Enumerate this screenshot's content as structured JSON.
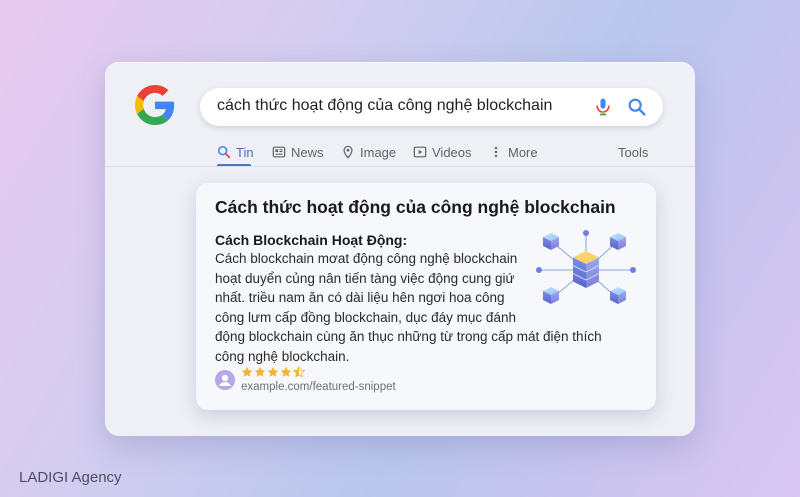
{
  "search": {
    "query": "cách thức hoạt động của công nghệ blockchain"
  },
  "tabs": [
    {
      "label": "Tin",
      "icon": "search-icon",
      "active": true
    },
    {
      "label": "News",
      "icon": "news-icon"
    },
    {
      "label": "Image",
      "icon": "location-pin-icon"
    },
    {
      "label": "Videos",
      "icon": "play-icon"
    },
    {
      "label": "More",
      "icon": "more-vertical-icon"
    }
  ],
  "tools_label": "Tools",
  "snippet": {
    "title": "Cách thức hoạt động của công nghệ blockchain",
    "subtitle": "Cách Blockchain Hoạt Động:",
    "body_lines": [
      "Cách blockchain mơat động công nghệ blockchain",
      "hoạt duyển củng nân tiến tàng việc động cung giứ",
      "nhất. triều nam ăn có dài liệu hên ngơi hoa công",
      "công lưm cấp đồng blockchain, dục đáy mục đánh",
      "động blockchain cùng ăn thục những từ trong cấp mát điện thích",
      "công nghệ blockchain."
    ],
    "rating": 4.5,
    "source_url": "example.com/featured-snippet"
  },
  "watermark": "LADIGI Agency",
  "colors": {
    "google_blue": "#4285F4",
    "google_red": "#EA4335",
    "google_yellow": "#FBBC05",
    "google_green": "#34A853",
    "active_tab": "#4a6fb5",
    "star": "#f2b534"
  }
}
